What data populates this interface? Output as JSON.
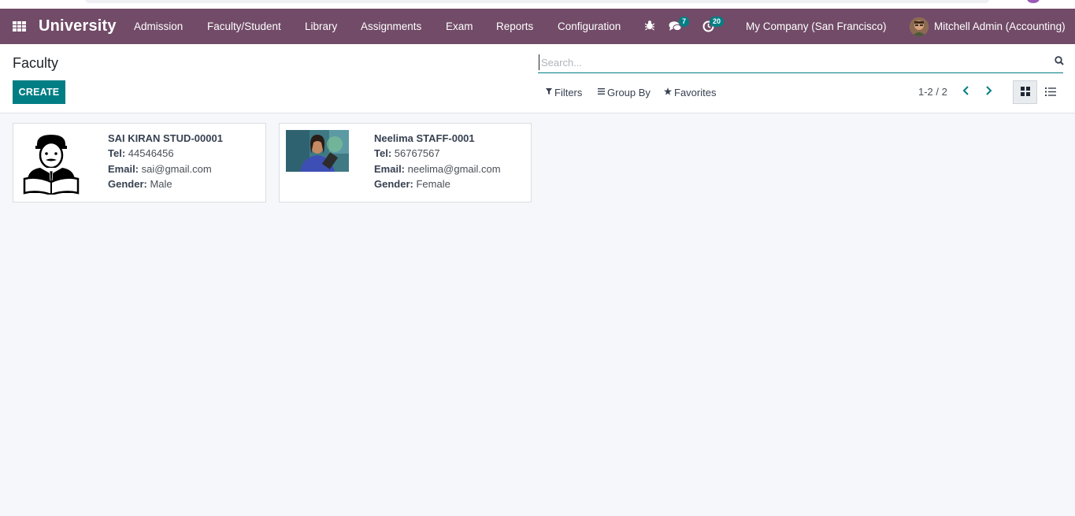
{
  "navbar": {
    "brand": "University",
    "menu": [
      "Admission",
      "Faculty/Student",
      "Library",
      "Assignments",
      "Exam",
      "Reports",
      "Configuration"
    ],
    "messages_count": "7",
    "activities_count": "20",
    "company": "My Company (San Francisco)",
    "user": "Mitchell Admin (Accounting)"
  },
  "control_panel": {
    "title": "Faculty",
    "create_label": "CREATE",
    "search_placeholder": "Search...",
    "filters_label": "Filters",
    "groupby_label": "Group By",
    "favorites_label": "Favorites",
    "pager": "1-2 / 2",
    "active_view": "kanban"
  },
  "cards": [
    {
      "name": "SAI KIRAN STUD-00001",
      "tel_label": "Tel:",
      "tel": "44546456",
      "email_label": "Email:",
      "email": "sai@gmail.com",
      "gender_label": "Gender:",
      "gender": "Male",
      "photo": "student-placeholder-icon"
    },
    {
      "name": "Neelima STAFF-0001",
      "tel_label": "Tel:",
      "tel": "56767567",
      "email_label": "Email:",
      "email": "neelima@gmail.com",
      "gender_label": "Gender:",
      "gender": "Female",
      "photo": "staff-photo"
    }
  ],
  "colors": {
    "navbar": "#714b67",
    "primary": "#017e84",
    "background": "#f6f7fa"
  }
}
